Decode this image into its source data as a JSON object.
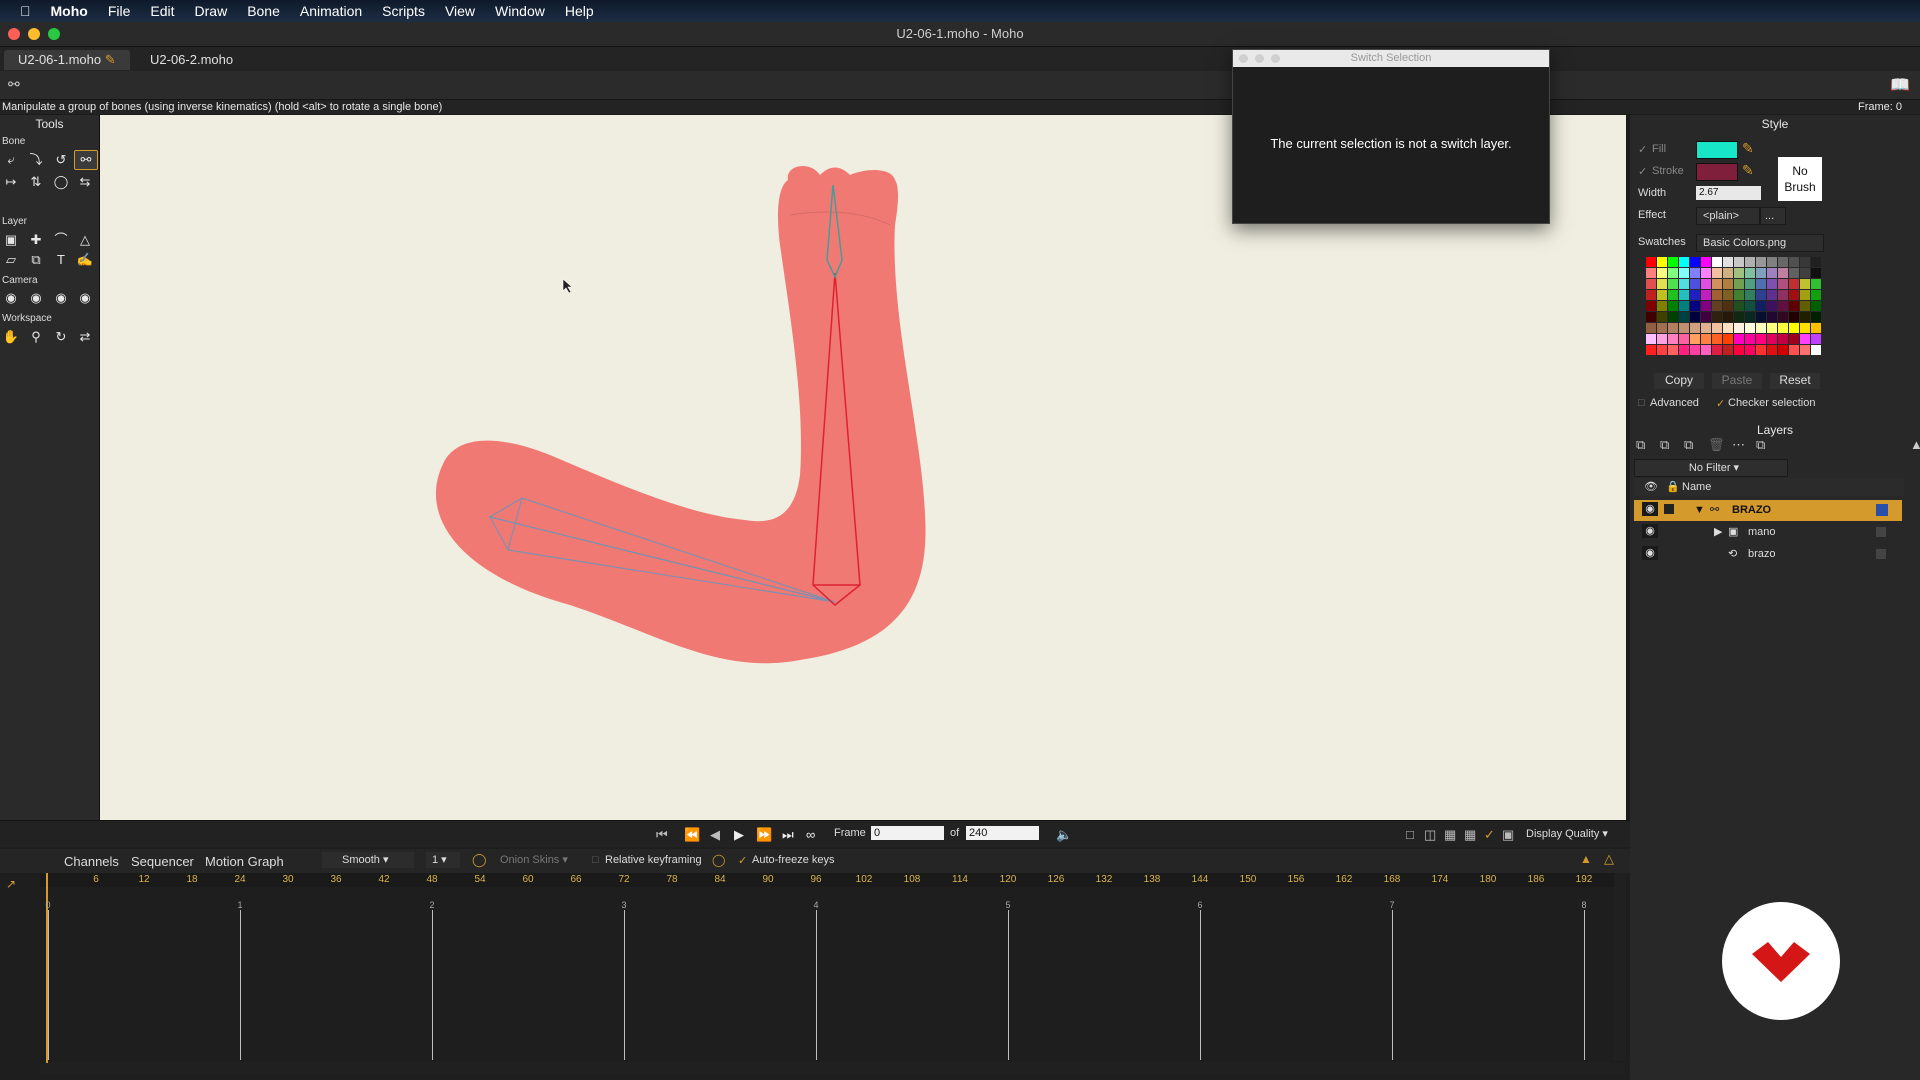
{
  "menubar": {
    "app": "Moho",
    "items": [
      "File",
      "Edit",
      "Draw",
      "Bone",
      "Animation",
      "Scripts",
      "View",
      "Window",
      "Help"
    ]
  },
  "window": {
    "title": "U2-06-1.moho - Moho"
  },
  "tabs": [
    {
      "label": "U2-06-1.moho",
      "modified": true
    },
    {
      "label": "U2-06-2.moho"
    }
  ],
  "status": {
    "hint": "Manipulate a group of bones (using inverse kinematics) (hold <alt> to rotate a single bone)",
    "frame": "Frame: 0"
  },
  "tools": {
    "title": "Tools",
    "sections": {
      "bone": "Bone",
      "layer": "Layer",
      "camera": "Camera",
      "workspace": "Workspace"
    }
  },
  "dialog": {
    "title": "Switch Selection",
    "message": "The current selection is not a switch layer."
  },
  "style": {
    "title": "Style",
    "fill_label": "Fill",
    "stroke_label": "Stroke",
    "fill_color": "#17e6c8",
    "stroke_color": "#7f1f3b",
    "no_brush": "No Brush",
    "width_label": "Width",
    "width_value": "2.67",
    "effect_label": "Effect",
    "effect_value": "<plain>",
    "effect_more": "...",
    "swatches_label": "Swatches",
    "swatches_value": "Basic Colors.png",
    "copy": "Copy",
    "paste": "Paste",
    "reset": "Reset",
    "advanced": "Advanced",
    "checker": "Checker selection"
  },
  "layers": {
    "title": "Layers",
    "filter": "No Filter",
    "col_name": "Name",
    "rows": [
      {
        "name": "BRAZO",
        "selected": true
      },
      {
        "name": "mano"
      },
      {
        "name": "brazo"
      }
    ]
  },
  "transport": {
    "frame_label": "Frame",
    "frame_value": "0",
    "of_label": "of",
    "total": "240",
    "quality": "Display Quality"
  },
  "timeline": {
    "tabs": [
      "Channels",
      "Sequencer",
      "Motion Graph"
    ],
    "interp": "Smooth",
    "interp_n": "1",
    "onion": "Onion Skins",
    "relative": "Relative keyframing",
    "autofreeze": "Auto-freeze keys",
    "ruler": [
      "6",
      "12",
      "18",
      "24",
      "30",
      "36",
      "42",
      "48",
      "54",
      "60",
      "66",
      "72",
      "78",
      "84",
      "90",
      "96",
      "102",
      "108",
      "114",
      "120",
      "126",
      "132",
      "138",
      "144",
      "150",
      "156",
      "162",
      "168",
      "174",
      "180",
      "186",
      "192"
    ],
    "seconds": [
      "0",
      "1",
      "2",
      "3",
      "4",
      "5",
      "6",
      "7",
      "8"
    ]
  }
}
